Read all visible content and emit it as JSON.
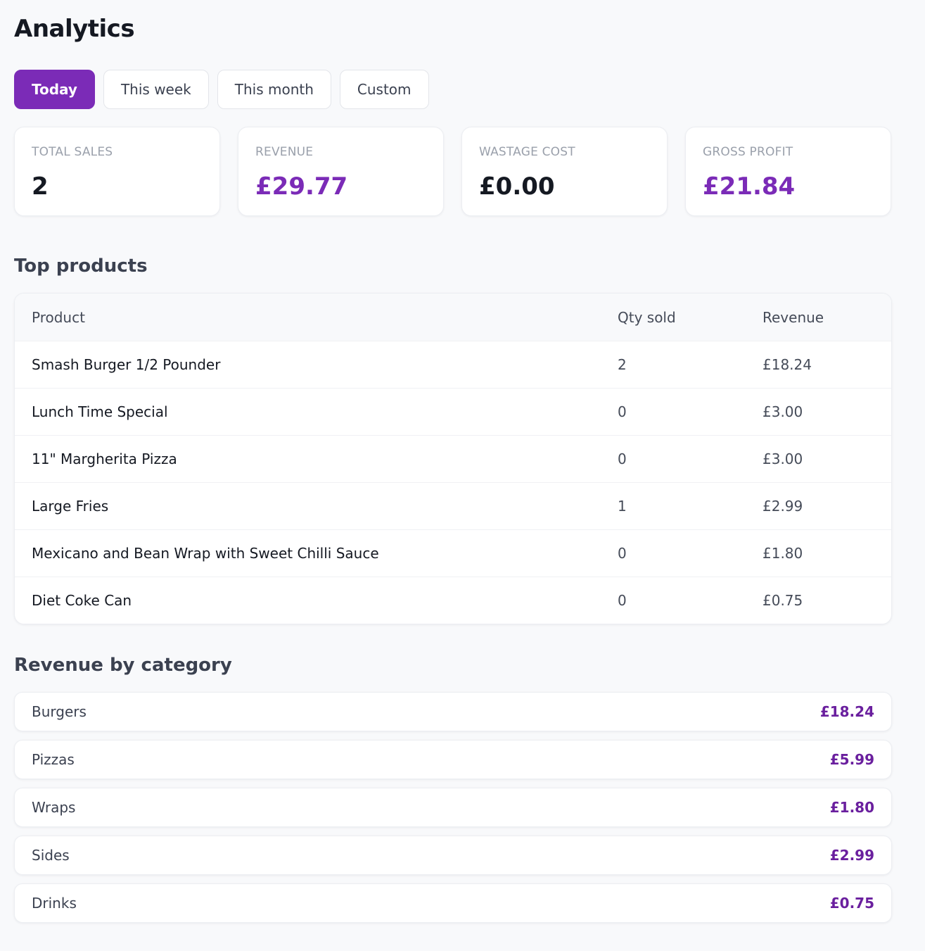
{
  "page": {
    "title": "Analytics"
  },
  "tabs": [
    {
      "label": "Today",
      "active": true
    },
    {
      "label": "This week",
      "active": false
    },
    {
      "label": "This month",
      "active": false
    },
    {
      "label": "Custom",
      "active": false
    }
  ],
  "stats": [
    {
      "label": "TOTAL SALES",
      "value": "2"
    },
    {
      "label": "REVENUE",
      "value": "£29.77"
    },
    {
      "label": "WASTAGE COST",
      "value": "£0.00"
    },
    {
      "label": "GROSS PROFIT",
      "value": "£21.84"
    }
  ],
  "top_products": {
    "title": "Top products",
    "columns": [
      "Product",
      "Qty sold",
      "Revenue"
    ],
    "rows": [
      {
        "product": "Smash Burger 1/2 Pounder",
        "qty": "2",
        "revenue": "£18.24"
      },
      {
        "product": "Lunch Time Special",
        "qty": "0",
        "revenue": "£3.00"
      },
      {
        "product": "11\" Margherita Pizza",
        "qty": "0",
        "revenue": "£3.00"
      },
      {
        "product": "Large Fries",
        "qty": "1",
        "revenue": "£2.99"
      },
      {
        "product": "Mexicano and Bean Wrap with Sweet Chilli Sauce",
        "qty": "0",
        "revenue": "£1.80"
      },
      {
        "product": "Diet Coke Can",
        "qty": "0",
        "revenue": "£0.75"
      }
    ]
  },
  "revenue_by_category": {
    "title": "Revenue by category",
    "items": [
      {
        "name": "Burgers",
        "value": "£18.24"
      },
      {
        "name": "Pizzas",
        "value": "£5.99"
      },
      {
        "name": "Wraps",
        "value": "£1.80"
      },
      {
        "name": "Sides",
        "value": "£2.99"
      },
      {
        "name": "Drinks",
        "value": "£0.75"
      }
    ]
  },
  "colors": {
    "accent": "#7b2bb7",
    "accent_text": "#6a1f9e",
    "background": "#f8f9fb"
  }
}
